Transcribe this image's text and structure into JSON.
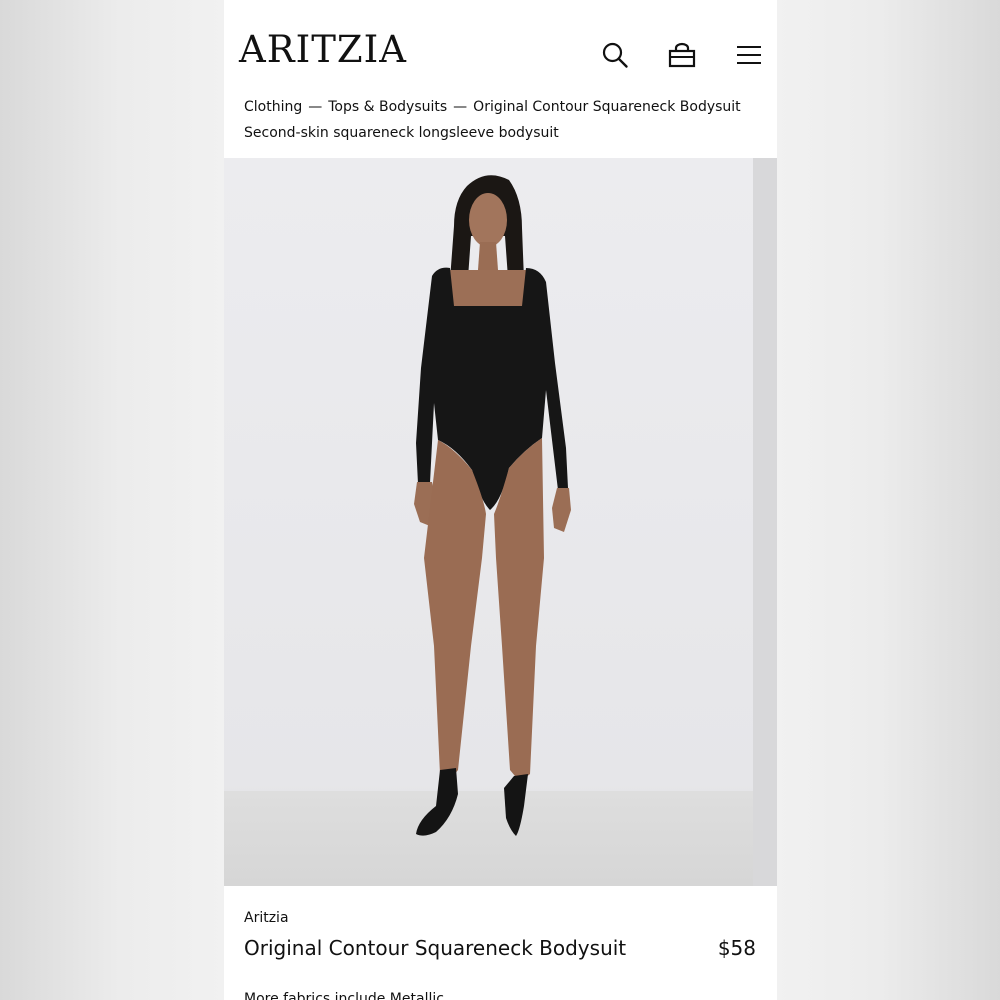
{
  "header": {
    "logo": "ARITZIA",
    "icons": [
      "search-icon",
      "bag-icon",
      "menu-icon"
    ]
  },
  "breadcrumb": {
    "items": [
      "Clothing",
      "Tops & Bodysuits",
      "Original Contour Squareneck Bodysuit"
    ],
    "separator": "—"
  },
  "subtitle": "Second-skin squareneck longsleeve bodysuit",
  "product": {
    "brand": "Aritzia",
    "name": "Original Contour Squareneck Bodysuit",
    "price": "$58",
    "fabric_note": "More fabrics include Metallic"
  },
  "colors": {
    "background": "#f1f1f1",
    "surface": "#ffffff",
    "text": "#111111",
    "photo_background": "#e7e7e9",
    "garment": "#161616"
  }
}
